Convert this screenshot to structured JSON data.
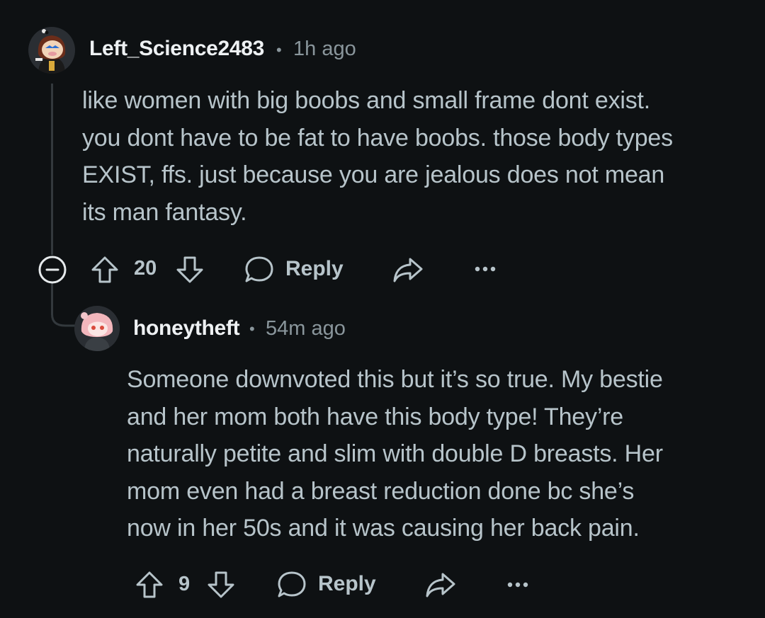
{
  "comments": [
    {
      "username": "Left_Science2483",
      "separator": "•",
      "time": "1h ago",
      "lines": [
        "like women with big boobs and small frame dont exist.",
        "you dont have to be fat to have boobs. those body types",
        "EXIST, ffs. just because you are jealous does not mean",
        "its man fantasy."
      ],
      "votes": "20",
      "reply_label": "Reply"
    },
    {
      "username": "honeytheft",
      "separator": "•",
      "time": "54m ago",
      "lines": [
        "Someone downvoted this but it’s so true. My bestie",
        "and her mom both have this body type! They’re",
        "naturally petite and slim with double D breasts. Her",
        "mom even had a breast reduction done bc she’s",
        "now in her 50s and it was causing her back pain."
      ],
      "votes": "9",
      "reply_label": "Reply"
    }
  ],
  "icons": {
    "collapse": "collapse-minus-icon",
    "upvote": "arrow-up-icon",
    "downvote": "arrow-down-icon",
    "reply": "speech-bubble-icon",
    "share": "share-arrow-icon",
    "more": "ellipsis-icon"
  },
  "colors": {
    "background": "#0e1113",
    "text": "#b7c4ca",
    "username": "#eef1f3",
    "muted": "#8a969c"
  }
}
